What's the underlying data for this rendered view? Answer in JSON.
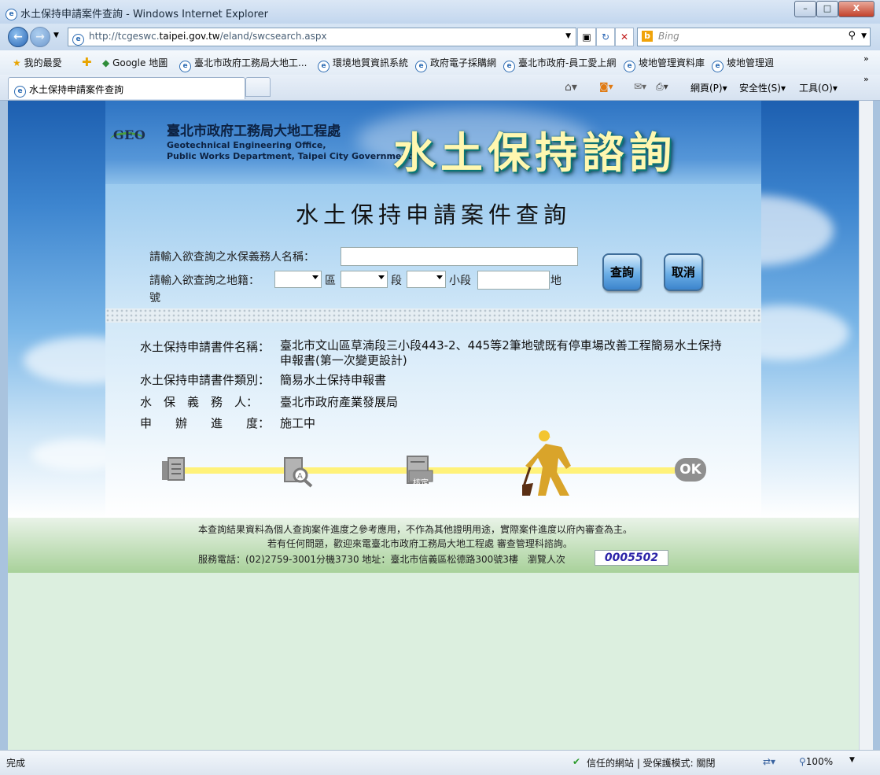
{
  "window": {
    "title": "水土保持申請案件查詢 - Windows Internet Explorer",
    "min_label": "–",
    "max_label": "□",
    "close_label": "X"
  },
  "nav": {
    "url_prefix": "http://tcgeswc.",
    "url_host": "taipei.gov.tw",
    "url_path": "/eland/swcsearch.aspx",
    "search_placeholder": "Bing"
  },
  "favorites": {
    "label": "我的最愛",
    "items": [
      "Google 地圖",
      "臺北市政府工務局大地工...",
      "環境地質資訊系統",
      "政府電子採購網",
      "臺北市政府-員工愛上網",
      "坡地管理資料庫",
      "坡地管理週"
    ]
  },
  "tab": {
    "label": "水土保持申請案件查詢"
  },
  "commands": {
    "page": "網頁(P)",
    "safety": "安全性(S)",
    "tools": "工具(O)"
  },
  "header": {
    "logo_text": "GEO",
    "org_cn": "臺北市政府工務局大地工程處",
    "org_en_1": "Geotechnical Engineering Office,",
    "org_en_2": "Public Works Department, Taipei City Government",
    "banner_title": "水土保持諮詢"
  },
  "form": {
    "page_title": "水土保持申請案件查詢",
    "name_label": "請輸入欲查詢之水保義務人名稱：",
    "name_value": "",
    "land_label": "請輸入欲查詢之地籍：",
    "district_unit": "區",
    "section_unit": "段",
    "subsection_unit": "小段",
    "lot_unit_1": "地",
    "lot_unit_2": "號",
    "search_button": "查詢",
    "cancel_button": "取消"
  },
  "result": {
    "name_label": "水土保持申請書件名稱：",
    "name_value": "臺北市文山區草湳段三小段443-2、445等2筆地號既有停車場改善工程簡易水土保持申報書(第一次變更設計)",
    "type_label": "水土保持申請書件類別：",
    "type_value": "簡易水土保持申報書",
    "obligor_label": "水　保　義　務　人：",
    "obligor_value": "臺北市政府產業發展局",
    "progress_label": "申　　辦　　進　　度：",
    "progress_value": "施工中"
  },
  "progress": {
    "steps": [
      "document-icon",
      "review-icon",
      "approve-icon",
      "construction-icon",
      "ok-icon"
    ],
    "approve_text": "核定",
    "ok_text": "OK",
    "current_step": 4,
    "total_steps": 5
  },
  "footer": {
    "line1": "本查詢結果資料為個人查詢案件進度之參考應用，不作為其他證明用途，實際案件進度以府內審查為主。",
    "line2": "若有任何問題，歡迎來電臺北市政府工務局大地工程處 審查管理科諮詢。",
    "line3": "服務電話：(02)2759-3001分機3730 地址：臺北市信義區松德路300號3樓　瀏覽人次",
    "counter": "0005502"
  },
  "status": {
    "left": "完成",
    "zone": "信任的網站 | 受保護模式: 關閉",
    "zoom": "100%"
  },
  "colors": {
    "accent": "#1d5fb0",
    "banner_text": "#fff7b0",
    "progress": "#fff27a",
    "counter": "#2c23a8"
  }
}
